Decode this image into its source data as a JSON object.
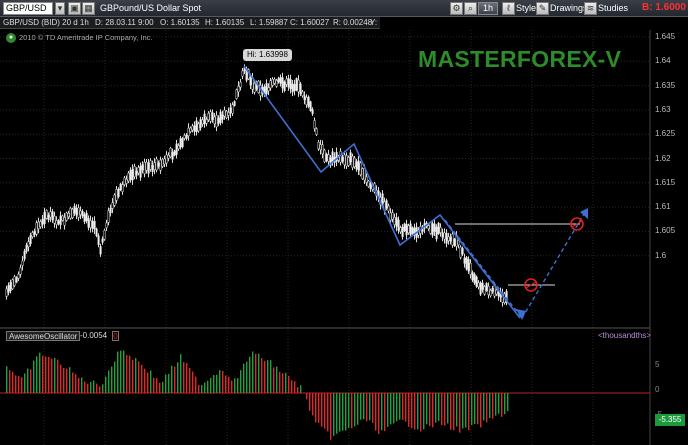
{
  "toolbar": {
    "symbol": "GBP/USD",
    "description": "GBPound/US Dollar Spot",
    "timeframe": "1h",
    "style_label": "Style",
    "drawings_label": "Drawings",
    "studies_label": "Studies",
    "last_price": "B: 1.6000"
  },
  "infobar": {
    "title": "GBP/USD (BID) 20 d 1h",
    "date": "D: 28.03.11 9:00",
    "open": "O: 1.60135",
    "high": "H: 1.60135",
    "low": "L: 1.59887",
    "close": "C: 1.60027",
    "range": "R: 0.00248",
    "y": "Y:"
  },
  "attribution": "2010 © TD Ameritrade IP Company, Inc.",
  "brand": "MASTERFOREX-V",
  "high_badge": "Hi: 1.63998",
  "price_axis": [
    "1.645",
    "1.64",
    "1.635",
    "1.63",
    "1.625",
    "1.62",
    "1.615",
    "1.61",
    "1.605",
    "1.6"
  ],
  "oscillator": {
    "name": "AwesomeOscillator",
    "value": "-0.0054",
    "box": "0",
    "units": "<thousandths>",
    "axis": [
      "5",
      "0",
      "-5"
    ],
    "tag": "-5.355"
  },
  "colors": {
    "bull": "#1fa33a",
    "bear": "#e02828",
    "zigzag": "#3f6fd1",
    "brand": "#2e8b2a",
    "marker": "#e02020"
  }
}
